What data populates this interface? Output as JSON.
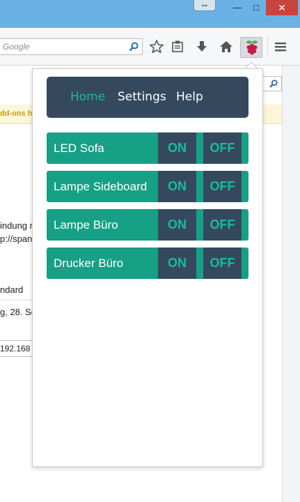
{
  "window": {
    "move_glyph": "⇔",
    "minimize_glyph": "—",
    "maximize_glyph": "□",
    "close_glyph": "✕",
    "titlebar_color": "#6ab2e6",
    "close_color": "#c8453d"
  },
  "toolbar": {
    "search_placeholder": "Google",
    "icons": [
      "search-icon",
      "bookmark-star-icon",
      "reading-list-icon",
      "download-icon",
      "home-icon",
      "raspberry-pi-icon",
      "hamburger-menu-icon"
    ]
  },
  "background_page": {
    "notice": "dd-ons h",
    "lines": [
      "indung n",
      "p://span",
      "ndard",
      "g, 28. Se",
      "192.168"
    ]
  },
  "popup": {
    "nav": {
      "home": "Home",
      "settings": "Settings",
      "help": "Help",
      "active": "home"
    },
    "devices": [
      {
        "name": "LED Sofa",
        "on_label": "ON",
        "off_label": "OFF"
      },
      {
        "name": "Lampe Sideboard",
        "on_label": "ON",
        "off_label": "OFF"
      },
      {
        "name": "Lampe Büro",
        "on_label": "ON",
        "off_label": "OFF"
      },
      {
        "name": "Drucker Büro",
        "on_label": "ON",
        "off_label": "OFF"
      }
    ],
    "colors": {
      "nav_bg": "#34495e",
      "nav_active": "#1abc9c",
      "row_bg": "#16a085",
      "button_bg": "#34495e",
      "button_text": "#1abc9c"
    }
  }
}
